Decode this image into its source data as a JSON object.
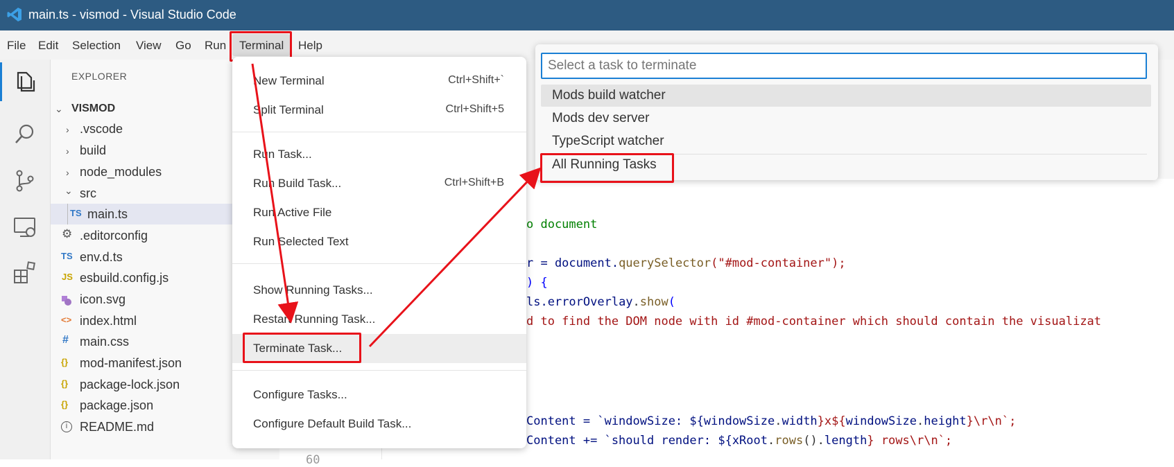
{
  "window": {
    "title": "main.ts - vismod - Visual Studio Code"
  },
  "menubar": {
    "items": [
      {
        "label": "File"
      },
      {
        "label": "Edit"
      },
      {
        "label": "Selection"
      },
      {
        "label": "View"
      },
      {
        "label": "Go"
      },
      {
        "label": "Run"
      },
      {
        "label": "Terminal"
      },
      {
        "label": "Help"
      }
    ]
  },
  "activity": [
    "explorer-icon",
    "search-icon",
    "source-control-icon",
    "remote-explorer-icon",
    "extensions-icon"
  ],
  "explorer": {
    "header": "EXPLORER",
    "root": "VISMOD",
    "items": [
      {
        "label": ".vscode",
        "icon": "chevron-right-icon"
      },
      {
        "label": "build",
        "icon": "chevron-right-icon"
      },
      {
        "label": "node_modules",
        "icon": "chevron-right-icon"
      },
      {
        "label": "src",
        "icon": "chevron-down-icon"
      },
      {
        "label": "main.ts",
        "badge": "TS"
      },
      {
        "label": ".editorconfig",
        "icon": "gear-icon"
      },
      {
        "label": "env.d.ts",
        "badge": "TS"
      },
      {
        "label": "esbuild.config.js",
        "badge": "JS"
      },
      {
        "label": "icon.svg",
        "icon": "svg-file-icon"
      },
      {
        "label": "index.html",
        "badge": "<>"
      },
      {
        "label": "main.css",
        "badge": "#"
      },
      {
        "label": "mod-manifest.json",
        "badge": "{}"
      },
      {
        "label": "package-lock.json",
        "badge": "{}"
      },
      {
        "label": "package.json",
        "badge": "{}"
      },
      {
        "label": "README.md",
        "icon": "info-icon"
      }
    ]
  },
  "terminal_menu": {
    "items": [
      {
        "label": "New Terminal",
        "shortcut": "Ctrl+Shift+`"
      },
      {
        "label": "Split Terminal",
        "shortcut": "Ctrl+Shift+5"
      },
      {
        "label": "Run Task...",
        "shortcut": ""
      },
      {
        "label": "Run Build Task...",
        "shortcut": "Ctrl+Shift+B"
      },
      {
        "label": "Run Active File",
        "shortcut": ""
      },
      {
        "label": "Run Selected Text",
        "shortcut": ""
      },
      {
        "label": "Show Running Tasks...",
        "shortcut": ""
      },
      {
        "label": "Restart Running Task...",
        "shortcut": ""
      },
      {
        "label": "Terminate Task...",
        "shortcut": ""
      },
      {
        "label": "Configure Tasks...",
        "shortcut": ""
      },
      {
        "label": "Configure Default Build Task...",
        "shortcut": ""
      }
    ]
  },
  "quick_pick": {
    "placeholder": "Select a task to terminate",
    "items": [
      {
        "label": "Mods build watcher"
      },
      {
        "label": "Mods dev server"
      },
      {
        "label": "TypeScript watcher"
      },
      {
        "label": "All Running Tasks"
      }
    ]
  },
  "code": {
    "line_partial": "60",
    "comment": "o document",
    "l1_a": "r = document.",
    "l1_b": "querySelector",
    "l1_c": "(\"#mod-container\");",
    "l2": ") {",
    "l3_a": "ls.",
    "l3_b": "errorOverlay",
    "l3_c": ".",
    "l3_d": "show",
    "l3_e": "(",
    "l4": "d to find the DOM node with id #mod-container which should contain the visualizat",
    "l5_a": "Content = `windowSize: ${",
    "l5_b": "windowSize",
    "l5_c": ".",
    "l5_d": "width",
    "l5_e": "}x${",
    "l5_f": "windowSize",
    "l5_g": ".",
    "l5_h": "height",
    "l5_i": "}\\r\\n`;",
    "l6_a": "Content += `should render: ${",
    "l6_b": "xRoot",
    "l6_c": ".",
    "l6_d": "rows",
    "l6_e": "().",
    "l6_f": "length",
    "l6_g": "} rows\\r\\n`;"
  },
  "colors": {
    "titlebar": "#2d5b82",
    "accent": "#1a7fd4",
    "highlight_red": "#e8121a",
    "string_red": "#a31515",
    "keyword_blue": "#0000ff",
    "variable_blue": "#001080",
    "function_brown": "#795e26",
    "comment_green": "#008000"
  }
}
